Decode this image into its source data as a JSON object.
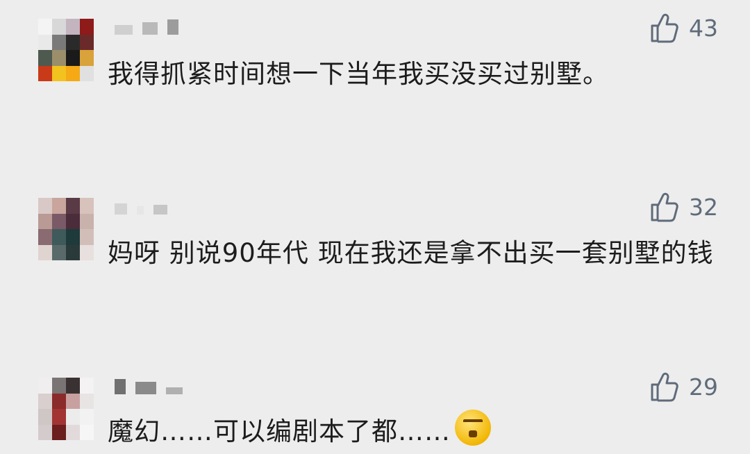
{
  "comments": [
    {
      "avatar_colors": [
        "#f4f4f4",
        "#d8d8d8",
        "#c4b4c0",
        "#8e1a1a",
        "#e9e9e9",
        "#7a7a7a",
        "#2a2a2a",
        "#6a2a2a",
        "#4e5a4f",
        "#9a8f6a",
        "#1a1a1a",
        "#d9a23a",
        "#c93a18",
        "#f2c21e",
        "#f4a915",
        "#e0e0e0"
      ],
      "username_colors": [
        "#cfcfcf",
        "#b9b9b9",
        "#9c9c9c"
      ],
      "likes": "43",
      "text": "我得抓紧时间想一下当年我买没买过别墅。",
      "like_icon": "thumbs-up-icon"
    },
    {
      "avatar_colors": [
        "#d9c9c6",
        "#c9a59e",
        "#5a3a44",
        "#d8c2bc",
        "#b99a94",
        "#7a5a66",
        "#4a2c3a",
        "#c9b2ac",
        "#8a6b72",
        "#3e5a5a",
        "#1e3a3a",
        "#d2beb8",
        "#e0d4d0",
        "#5a6a6a",
        "#2a3a3a",
        "#e8e0de"
      ],
      "username_colors": [
        "#d4d4d4",
        "#e6e6e6",
        "#c6c6c6"
      ],
      "likes": "32",
      "text": "妈呀 别说90年代 现在我还是拿不出买一套别墅的钱",
      "like_icon": "thumbs-up-icon"
    },
    {
      "avatar_colors": [
        "#f0eeee",
        "#7a7474",
        "#3a3232",
        "#f4f2f2",
        "#d9cfcf",
        "#8a2a2a",
        "#c9a0a0",
        "#e8e4e4",
        "#cfc6c6",
        "#a23434",
        "#ececec",
        "#f2f2f2",
        "#d4cccc",
        "#6a1e1e",
        "#e2dada",
        "#f6f6f6"
      ],
      "username_colors": [
        "#707070",
        "#8a8a8a",
        "#b0b0b0"
      ],
      "likes": "29",
      "text": "魔幻……可以编剧本了都……",
      "like_icon": "thumbs-up-icon"
    }
  ],
  "theme": {
    "background": "#ededed",
    "text_color": "#1c1c1c",
    "like_color": "#5f6b7a"
  }
}
